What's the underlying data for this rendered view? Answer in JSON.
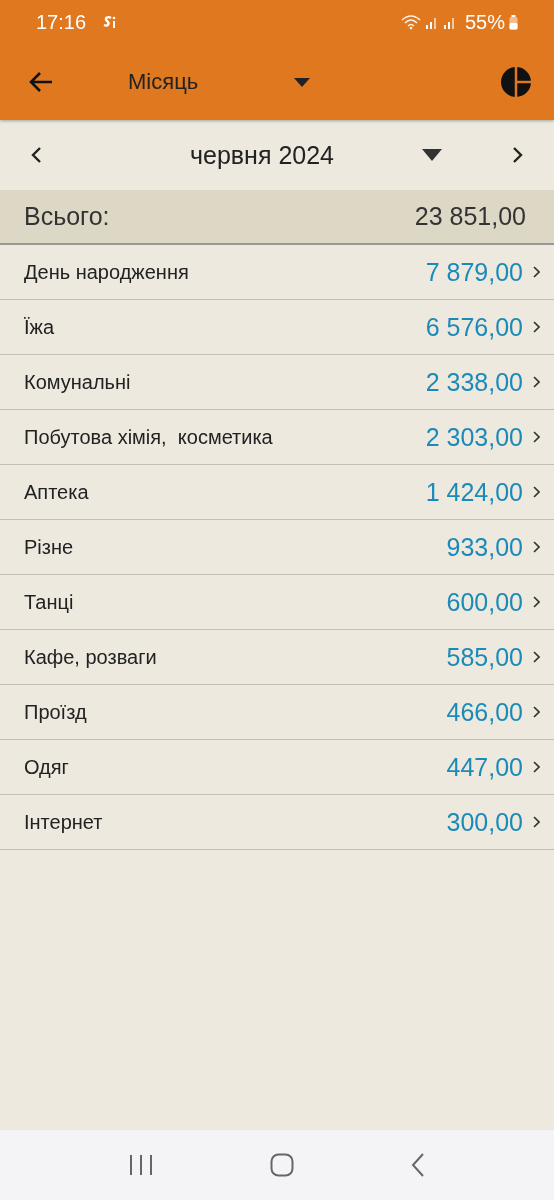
{
  "status_bar": {
    "time": "17:16",
    "battery": "55%"
  },
  "app_bar": {
    "period": "Місяць"
  },
  "date_nav": {
    "label": "червня 2024"
  },
  "total": {
    "label": "Всього:",
    "amount": "23 851,00"
  },
  "categories": [
    {
      "name": "День народження",
      "amount": "7 879,00"
    },
    {
      "name": "Їжа",
      "amount": "6 576,00"
    },
    {
      "name": "Комунальні",
      "amount": "2 338,00"
    },
    {
      "name": "Побутова хімія,  косметика",
      "amount": "2 303,00"
    },
    {
      "name": "Аптека",
      "amount": "1 424,00"
    },
    {
      "name": "Різне",
      "amount": "933,00"
    },
    {
      "name": "Танці",
      "amount": "600,00"
    },
    {
      "name": "Кафе, розваги",
      "amount": "585,00"
    },
    {
      "name": "Проїзд",
      "amount": "466,00"
    },
    {
      "name": "Одяг",
      "amount": "447,00"
    },
    {
      "name": "Інтернет",
      "amount": "300,00"
    }
  ]
}
